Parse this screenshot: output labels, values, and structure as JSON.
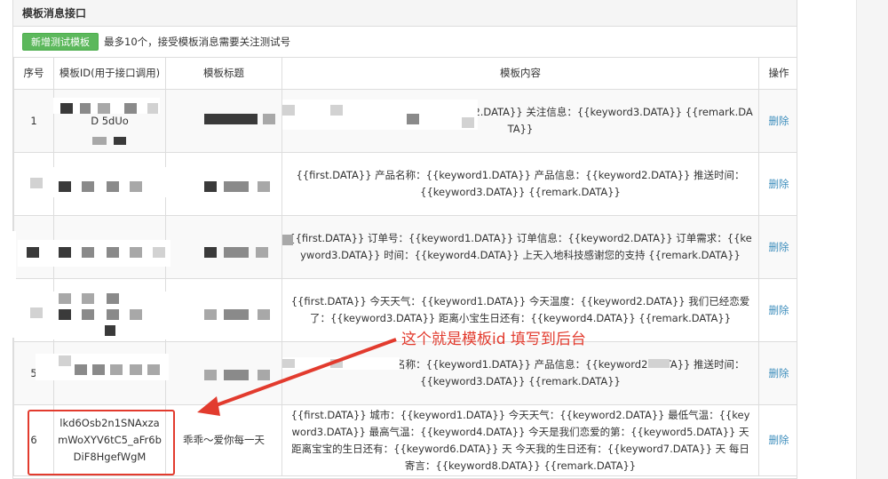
{
  "panel": {
    "title": "模板消息接口",
    "add_button": "新增测试模板",
    "note": "最多10个，接受模板消息需要关注测试号"
  },
  "table": {
    "headers": [
      "序号",
      "模板ID(用于接口调用)",
      "模板标题",
      "模板内容",
      "操作"
    ],
    "rows": [
      {
        "index": "1",
        "id": "D 5dUo",
        "title": "",
        "content": "{{first.DATA}} 关注时间：{{keyword2.DATA}} 关注信息：{{keyword3.DATA}} {{remark.DATA}}",
        "op": "删除"
      },
      {
        "index": "2",
        "id": "JwVPLdiNwF...eBKV",
        "title": "",
        "content": "{{first.DATA}} 产品名称：{{keyword1.DATA}} 产品信息：{{keyword2.DATA}} 推送时间：{{keyword3.DATA}} {{remark.DATA}}",
        "op": "删除"
      },
      {
        "index": "3",
        "id": "BmUuD6xOQEXFi3",
        "title": "",
        "content": "{{first.DATA}} 订单号：{{keyword1.DATA}} 订单信息：{{keyword2.DATA}} 订单需求：{{keyword3.DATA}} 时间：{{keyword4.DATA}} 上天入地科技感谢您的支持 {{remark.DATA}}",
        "op": "删除"
      },
      {
        "index": "4",
        "id": "XZ str",
        "title": "",
        "content": "{{first.DATA}} 今天天气：{{keyword1.DATA}} 今天温度：{{keyword2.DATA}} 我们已经恋爱了：{{keyword3.DATA}} 距离小宝生日还有：{{keyword4.DATA}} {{remark.DATA}}",
        "op": "删除"
      },
      {
        "index": "5",
        "id": "s7OAhk",
        "title": "",
        "content": "{{first.DATA}} 产品名称：{{keyword1.DATA}} 产品信息：{{keyword2.DATA}} 推送时间：{{keyword3.DATA}} {{remark.DATA}}",
        "op": "删除"
      },
      {
        "index": "6",
        "id": "lkd6Osb2n1SNAxzamWoXYV6tC5_aFr6bDiF8HgefWgM",
        "title": "乖乖～爱你每一天",
        "content": "{{first.DATA}} 城市：{{keyword1.DATA}} 今天天气：{{keyword2.DATA}} 最低气温：{{keyword3.DATA}} 最高气温：{{keyword4.DATA}} 今天是我们恋爱的第：{{keyword5.DATA}} 天 距离宝宝的生日还有：{{keyword6.DATA}} 天 今天我的生日还有：{{keyword7.DATA}} 天 每日寄言：{{keyword8.DATA}} {{remark.DATA}}",
        "op": "删除"
      }
    ]
  },
  "annotation": {
    "text": "这个就是模板id 填写到后台",
    "color": "#e23b2e"
  }
}
